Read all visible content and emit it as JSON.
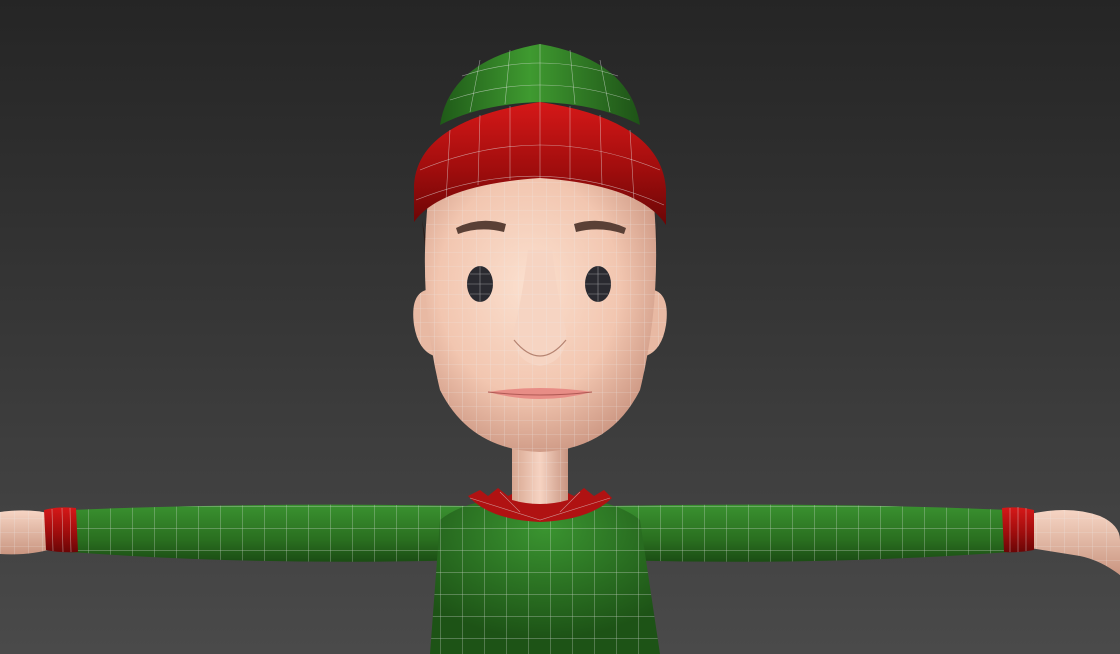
{
  "viewport": {
    "background_top": "#252525",
    "background_bottom": "#4a4a4a"
  },
  "model": {
    "hat_color": "#2e7a24",
    "hat_band_color": "#b01010",
    "skin_color": "#f2c6b0",
    "shirt_color": "#2f7d25",
    "cuff_color": "#a81212",
    "eye_color": "#2a2a30",
    "brow_color": "#5a4036",
    "wire_color": "#e6e6e6"
  }
}
